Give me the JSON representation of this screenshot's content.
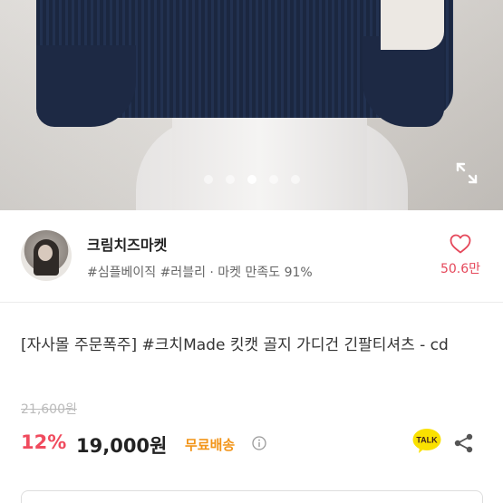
{
  "hero": {
    "slide_count": 5,
    "active_slide": 3
  },
  "shop": {
    "name": "크림치즈마켓",
    "tags": "#심플베이직 #러블리 · 마켓 만족도 91%",
    "like_count": "50.6만"
  },
  "product": {
    "title": "[자사몰 주문폭주] #크치Made 킷캣 골지 가디건 긴팔티셔츠 - cd",
    "original_price": "21,600원",
    "discount": "12%",
    "price": "19,000원",
    "shipping": "무료배송",
    "talk_label": "TALK"
  },
  "colors": {
    "discount": "#f04b5e",
    "shipping": "#f29418",
    "like": "#e5475a",
    "talk_bubble": "#3c1e1e"
  },
  "icons": [
    "expand-icon",
    "heart-icon",
    "info-icon",
    "kakao-talk-icon",
    "share-icon"
  ]
}
